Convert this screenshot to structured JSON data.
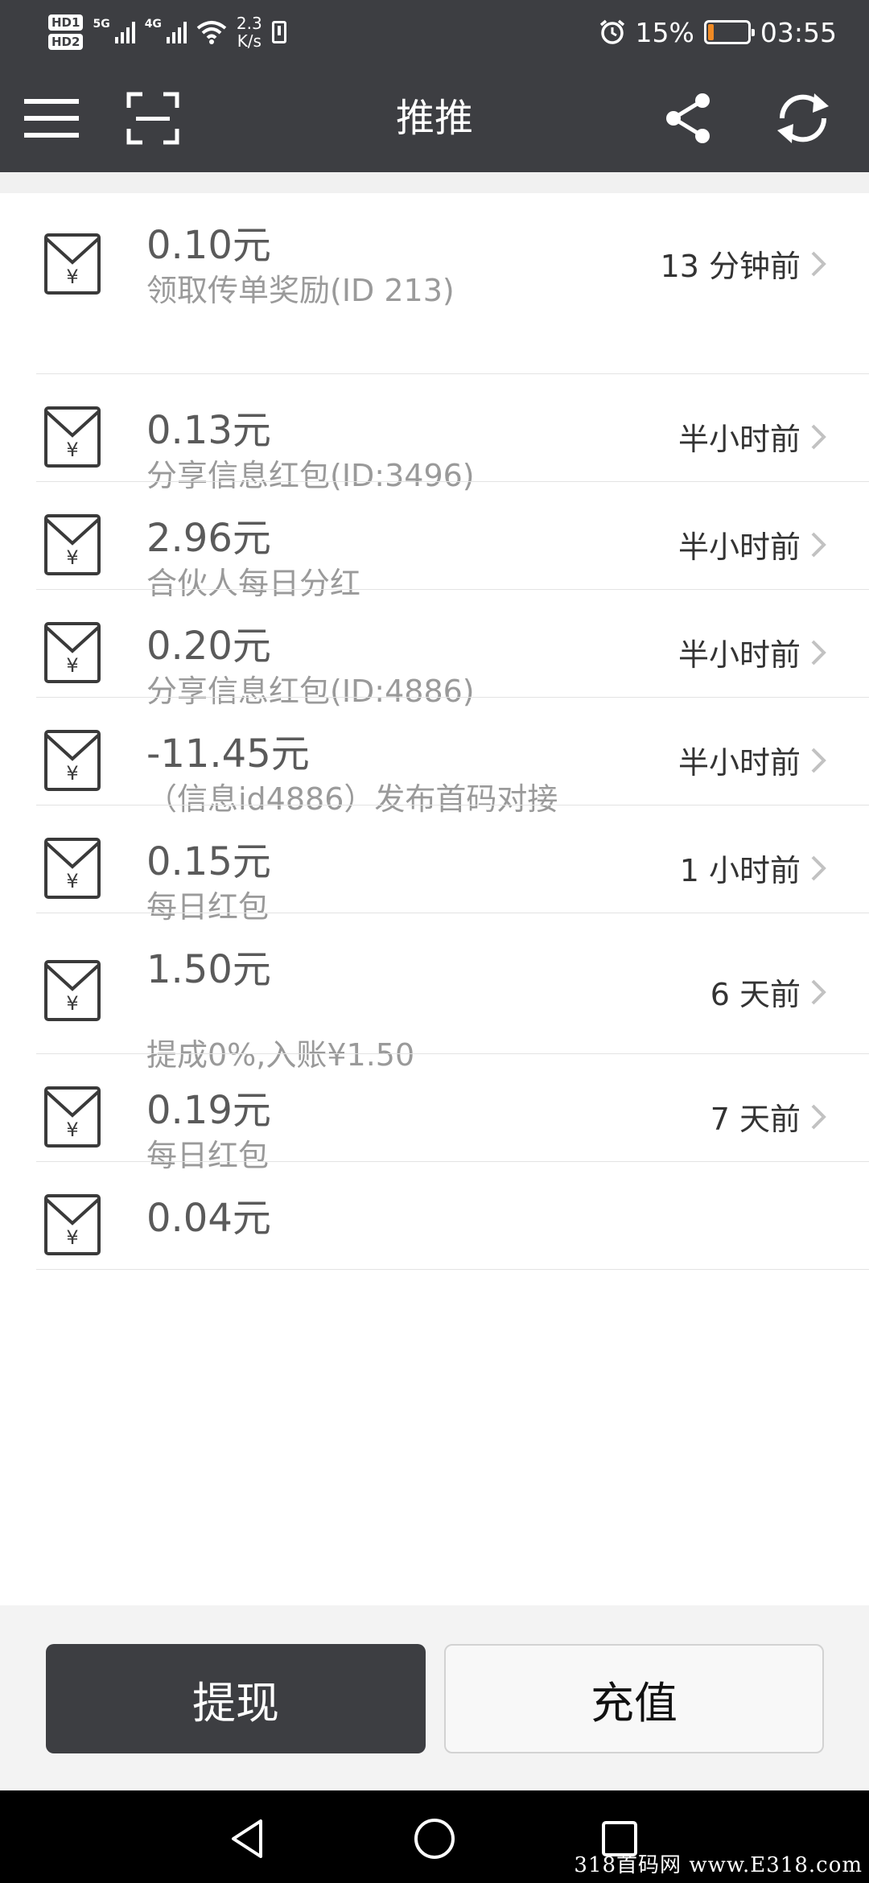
{
  "status_bar": {
    "hd1": "HD1",
    "hd2": "HD2",
    "net1": "5G",
    "net2": "4G",
    "speed_value": "2.3",
    "speed_unit": "K/s",
    "battery_percent": "15%",
    "battery_level": 0.15,
    "time": "03:55"
  },
  "toolbar": {
    "title": "推推",
    "menu_icon": "menu-icon",
    "scan_icon": "scan-icon",
    "share_icon": "share-icon",
    "refresh_icon": "refresh-icon"
  },
  "transactions": [
    {
      "amount": "0.10元",
      "desc": "领取传单奖励(ID 213)",
      "time": "13 分钟前"
    },
    {
      "amount": "0.13元",
      "desc": "分享信息红包(ID:3496)",
      "time": "半小时前"
    },
    {
      "amount": "2.96元",
      "desc": "合伙人每日分红",
      "time": "半小时前"
    },
    {
      "amount": "0.20元",
      "desc": "分享信息红包(ID:4886)",
      "time": "半小时前"
    },
    {
      "amount": "-11.45元",
      "desc": "（信息id4886）发布首码对接",
      "time": "半小时前"
    },
    {
      "amount": "0.15元",
      "desc": "每日红包",
      "time": "1 小时前"
    },
    {
      "amount": "1.50元",
      "desc": "提成0%,入账¥1.50",
      "time": "6 天前"
    },
    {
      "amount": "0.19元",
      "desc": "每日红包",
      "time": "7 天前"
    },
    {
      "amount": "0.04元",
      "desc": "",
      "time": ""
    }
  ],
  "buttons": {
    "withdraw": "提现",
    "recharge": "充值"
  },
  "watermark": "318首码网 www.E318.com"
}
